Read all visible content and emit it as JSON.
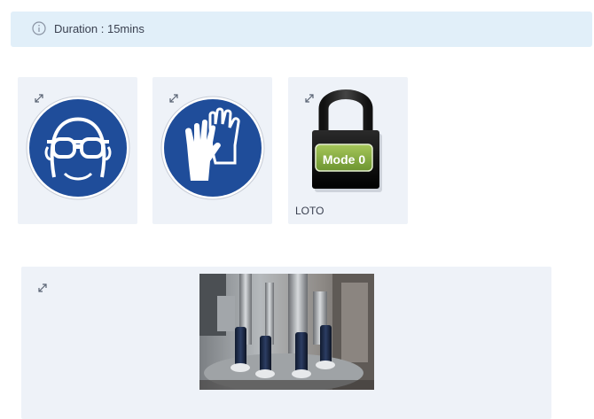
{
  "banner": {
    "duration_text": "Duration : 15mins",
    "icon": "info-circle-icon"
  },
  "ppe_cards": [
    {
      "name": "safety-goggles",
      "icon": "safety-goggles-icon",
      "caption": ""
    },
    {
      "name": "safety-gloves",
      "icon": "safety-gloves-icon",
      "caption": ""
    },
    {
      "name": "loto-padlock",
      "icon": "padlock-icon",
      "caption": "LOTO",
      "badge": "Mode 0"
    }
  ],
  "media_card": {
    "icon": "expand-icon",
    "image": "machine-photo"
  },
  "colors": {
    "banner_bg": "#e1eff9",
    "card_bg": "#eef2f8",
    "ppe_blue": "#1f4d9a",
    "badge_green": "#7fa83a"
  }
}
